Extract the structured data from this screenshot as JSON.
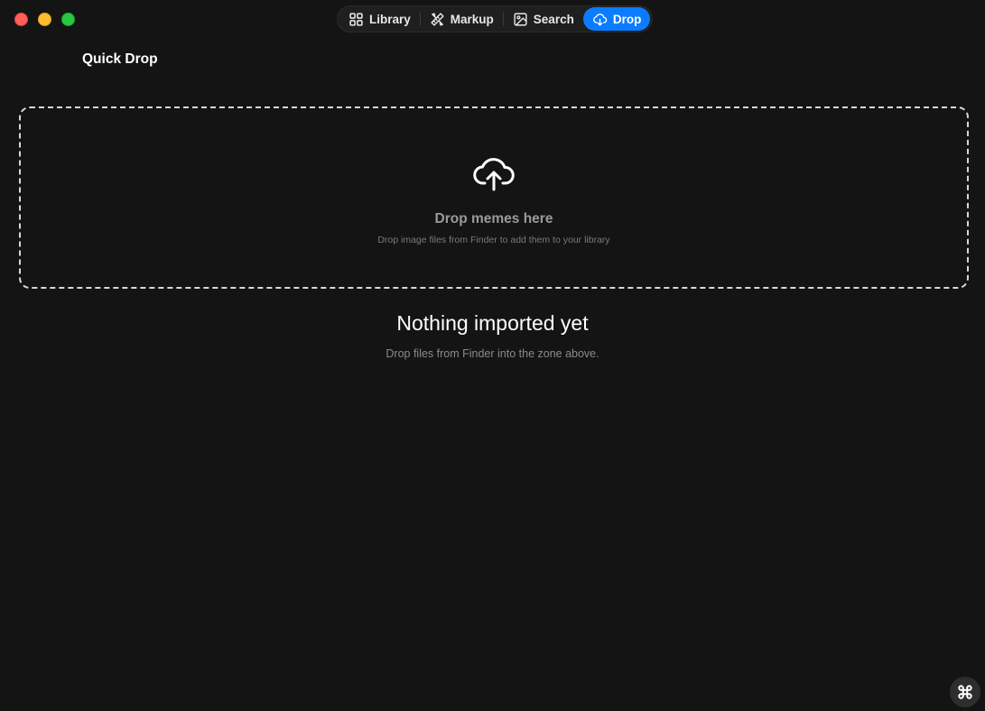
{
  "toolbar": {
    "tabs": [
      {
        "label": "Library",
        "icon": "grid-icon",
        "active": false
      },
      {
        "label": "Markup",
        "icon": "pencil-ruler-icon",
        "active": false
      },
      {
        "label": "Search",
        "icon": "image-search-icon",
        "active": false
      },
      {
        "label": "Drop",
        "icon": "cloud-download-icon",
        "active": true
      }
    ],
    "accent_color": "#0a7cff"
  },
  "page": {
    "title": "Quick Drop"
  },
  "dropzone": {
    "icon": "cloud-upload-icon",
    "title": "Drop memes here",
    "subtitle": "Drop image files from Finder to add them to your library"
  },
  "empty_state": {
    "title": "Nothing imported yet",
    "subtitle": "Drop files from Finder into the zone above."
  },
  "corner_button": {
    "icon": "command-icon"
  },
  "colors": {
    "background": "#141414",
    "traffic_close": "#ff5f57",
    "traffic_minimize": "#febc2e",
    "traffic_maximize": "#28c840"
  }
}
